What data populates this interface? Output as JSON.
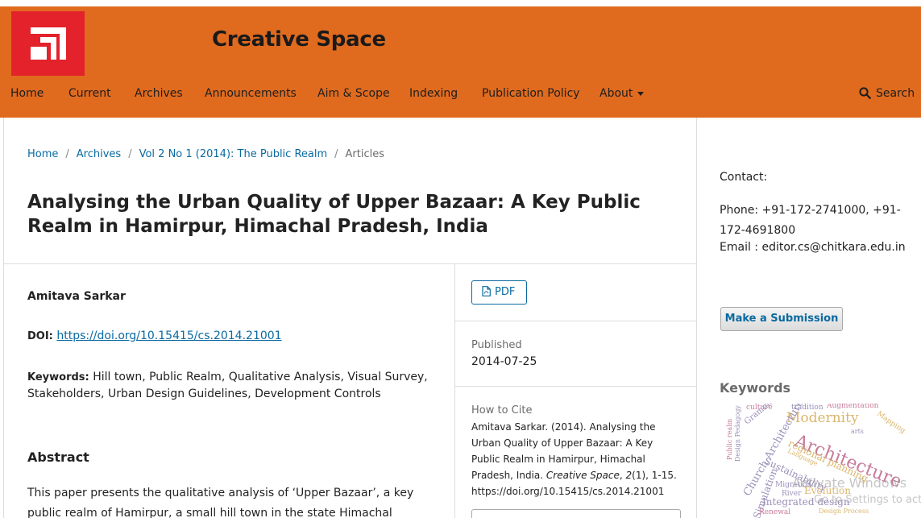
{
  "header": {
    "site_title": "Creative Space",
    "logo_icon": "creative-space-logo",
    "colors": {
      "header_bg": "#e06b1f",
      "logo_bg": "#e3222b",
      "link": "#0a6aa1"
    }
  },
  "nav": {
    "items": [
      "Home",
      "Current",
      "Archives",
      "Announcements",
      "Aim & Scope",
      "Indexing",
      "Publication Policy",
      "About"
    ],
    "search_label": "Search"
  },
  "breadcrumb": {
    "home": "Home",
    "archives": "Archives",
    "issue": "Vol 2 No 1 (2014): The Public Realm",
    "current": "Articles",
    "separator": "/"
  },
  "article": {
    "title": "Analysing the Urban Quality of Upper Bazaar: A Key Public Realm in Hamirpur, Himachal Pradesh, India",
    "author": "Amitava Sarkar",
    "doi_label": "DOI:",
    "doi_url": "https://doi.org/10.15415/cs.2014.21001",
    "keywords_label": "Keywords:",
    "keywords": "Hill town, Public Realm, Qualitative Analysis, Visual Survey, Stakeholders, Urban Design Guidelines, Development Controls",
    "abstract_heading": "Abstract",
    "abstract_text": "This paper presents the qualitative analysis of ‘Upper Bazaar’, a key public realm of Hamirpur, a small hill town in the state Himachal Pradesh, India."
  },
  "article_sidebar": {
    "pdf_label": "PDF",
    "published_label": "Published",
    "published_date": "2014-07-25",
    "how_to_cite_label": "How to Cite",
    "citation_main": "Amitava Sarkar. (2014). Analysing the Urban Quality of Upper Bazaar: A Key Public Realm in Hamirpur, Himachal Pradesh, India.",
    "citation_journal": "Creative Space",
    "citation_volume": "2",
    "citation_rest": "(1), 1-15.",
    "citation_doi": "https://doi.org/10.15415/cs.2014.21001"
  },
  "sidebar": {
    "contact_label": "Contact:",
    "phone": "Phone: +91-172-2741000, +91-172-4691800",
    "email": "Email : editor.cs@chitkara.edu.in",
    "submit_label": "Make a Submission",
    "keywords_heading": "Keywords",
    "cloud_words": [
      "culture",
      "tradition",
      "Augmentation",
      "Modernity",
      "Grammar",
      "Architecture",
      "Public realm",
      "Design Pedagogy",
      "Church Architecture",
      "regional planning",
      "Sustainability",
      "Simulation",
      "Migration",
      "River",
      "Evolution",
      "Integrated design",
      "Renewal",
      "Design Process",
      "arts",
      "Mapping",
      "Language"
    ]
  },
  "watermark": {
    "line1": "Activate Windows",
    "line2": "Go to Settings to activat"
  }
}
